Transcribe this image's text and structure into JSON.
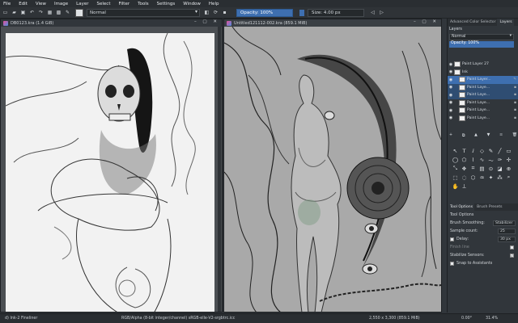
{
  "menu": [
    "File",
    "Edit",
    "View",
    "Image",
    "Layer",
    "Select",
    "Filter",
    "Tools",
    "Settings",
    "Window",
    "Help"
  ],
  "toolbar": {
    "blend_mode": "Normal",
    "opacity": "Opacity: 100%",
    "size": "Size: 4.00 px"
  },
  "windows": {
    "left_title": "DB0123.kra (1.4 GiB)",
    "right_title": "Untitled121112-002.kra (859.1 MiB)"
  },
  "docker": {
    "tabs": [
      "Advanced Color Selector",
      "Layers"
    ],
    "layers_header": "Layers",
    "blend_mode": "Normal",
    "opacity": "Opacity: 100%",
    "layers": [
      {
        "name": "Paint Layer 27"
      },
      {
        "name": "Ink"
      },
      {
        "name": "Paint Layer..."
      },
      {
        "name": "Paint Laye..."
      },
      {
        "name": "Paint Laye..."
      },
      {
        "name": "Paint Laye..."
      },
      {
        "name": "Paint Laye..."
      },
      {
        "name": "Paint Laye..."
      }
    ],
    "tool_tabs": [
      "Tool Options",
      "Brush Presets"
    ],
    "tool_options_header": "Tool Options",
    "brush_smoothing_label": "Brush Smoothing:",
    "brush_smoothing_value": "Stabilizer",
    "sample_count_label": "Sample count:",
    "sample_count_value": "25",
    "delay_label": "Delay:",
    "delay_value": "30 px",
    "finish_line_label": "Finish line",
    "stabilize_sensors_label": "Stabilize Sensors:",
    "snap_label": "Snap to Assistants"
  },
  "status": {
    "brush": "d) Ink-2 Fineliner",
    "colorspace": "RGB/Alpha (8-bit integer/channel)  sRGB-elle-V2-srgbtrc.icc",
    "dimensions": "2,550 x 3,300 (859.1 MiB)",
    "rotation": "0.00°",
    "zoom": "31.4%"
  },
  "colors": {
    "accent": "#3e6fb0",
    "bg": "#31363b",
    "canvas_gray": "#a9a9a9"
  }
}
